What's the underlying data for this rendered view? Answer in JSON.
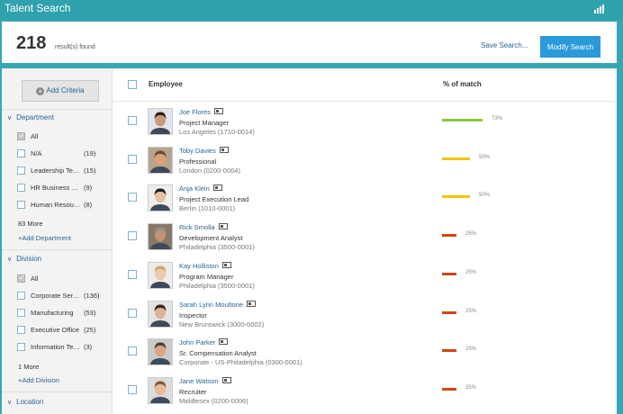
{
  "window": {
    "title": "Talent Search",
    "chart_icon": "bar-chart-icon"
  },
  "results": {
    "count": "218",
    "label": "result(s) found"
  },
  "actions": {
    "save_search": "Save Search...",
    "modify_search": "Modify Search"
  },
  "sidebar": {
    "add_criteria": "Add Criteria",
    "department": {
      "title": "Department",
      "items": [
        {
          "label": "All",
          "count": "",
          "checked": true
        },
        {
          "label": "N/A",
          "count": "(19)",
          "checked": false
        },
        {
          "label": "Leadership Team",
          "count": "(15)",
          "checked": false
        },
        {
          "label": "HR Business Partner",
          "count": "(9)",
          "checked": false
        },
        {
          "label": "Human Resources",
          "count": "(8)",
          "checked": false
        }
      ],
      "more": "83 More",
      "add": "+Add Department"
    },
    "division": {
      "title": "Division",
      "items": [
        {
          "label": "All",
          "count": "",
          "checked": true
        },
        {
          "label": "Corporate Services",
          "count": "(136)",
          "checked": false
        },
        {
          "label": "Manufacturing",
          "count": "(53)",
          "checked": false
        },
        {
          "label": "Executive Office",
          "count": "(25)",
          "checked": false
        },
        {
          "label": "Information Technology",
          "count": "(3)",
          "checked": false
        }
      ],
      "more": "1 More",
      "add": "+Add Division"
    },
    "location": {
      "title": "Location"
    }
  },
  "table": {
    "col_employee": "Employee",
    "col_match": "% of match",
    "rows": [
      {
        "name": "Joe Flores",
        "role": "Project Manager",
        "location": "Los Angeles (1710-0014)",
        "match": "73%",
        "match_value": 73,
        "color": "#8cc63f",
        "skin": "#c99a7a",
        "hair": "#2b2018",
        "bg": "#dfe5ea"
      },
      {
        "name": "Toby Davies",
        "role": "Professional",
        "location": "London (0200-0004)",
        "match": "50%",
        "match_value": 50,
        "color": "#f5c400",
        "skin": "#d9a27c",
        "hair": "#6b4a32",
        "bg": "#b9a38d"
      },
      {
        "name": "Anja Klein",
        "role": "Project Execution Lead",
        "location": "Berlin (1010-0001)",
        "match": "50%",
        "match_value": 50,
        "color": "#f5c400",
        "skin": "#e7c1a6",
        "hair": "#2a1d17",
        "bg": "#eeeeee"
      },
      {
        "name": "Rick Smolla",
        "role": "Development Analyst",
        "location": "Philadelphia (3500-0001)",
        "match": "25%",
        "match_value": 25,
        "color": "#d0451b",
        "skin": "#c49273",
        "hair": "#8f8f8f",
        "bg": "#87786a"
      },
      {
        "name": "Kay Holliston",
        "role": "Program Manager",
        "location": "Philadelphia (3500-0001)",
        "match": "25%",
        "match_value": 25,
        "color": "#d0451b",
        "skin": "#edc9ad",
        "hair": "#cfa86a",
        "bg": "#ececec"
      },
      {
        "name": "Sarah Lynn Moultone",
        "role": "Inspector",
        "location": "New Brunswick (3000-0002)",
        "match": "25%",
        "match_value": 25,
        "color": "#d0451b",
        "skin": "#ddb298",
        "hair": "#3b2519",
        "bg": "#e3e3e3"
      },
      {
        "name": "John Parker",
        "role": "Sr. Compensation Analyst",
        "location": "Corporate - US-Philadelphia (0300-0001)",
        "match": "25%",
        "match_value": 25,
        "color": "#d0451b",
        "skin": "#d7a686",
        "hair": "#5a3c29",
        "bg": "#cbcbcb"
      },
      {
        "name": "Jane Watson",
        "role": "Recruiter",
        "location": "Middlesex (0200-0006)",
        "match": "25%",
        "match_value": 25,
        "color": "#d0451b",
        "skin": "#e5bc9c",
        "hair": "#8a5a35",
        "bg": "#dcdcdc"
      }
    ]
  }
}
